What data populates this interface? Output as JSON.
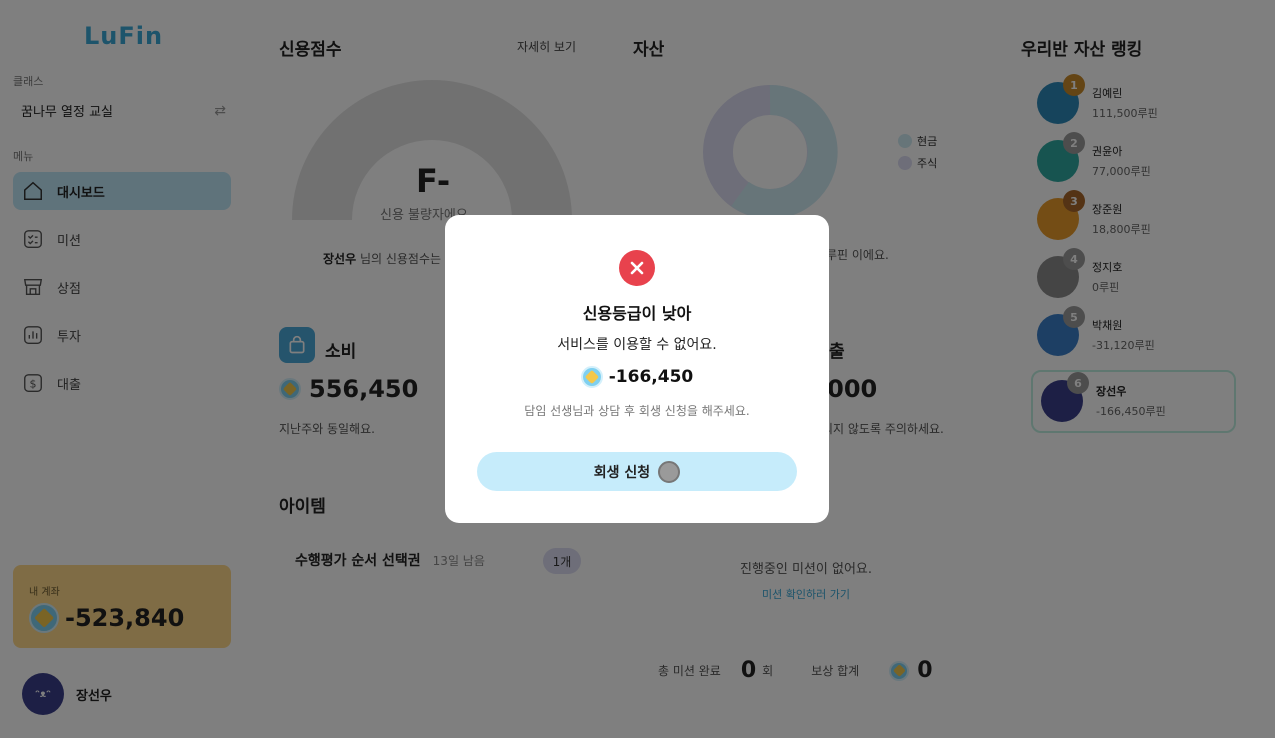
{
  "app": {
    "logo": "LuFin"
  },
  "sidebar": {
    "class_label": "클래스",
    "class_name": "꿈나무 열정 교실",
    "menu_label": "메뉴",
    "items": [
      {
        "label": "대시보드",
        "icon": "home-icon",
        "active": true
      },
      {
        "label": "미션",
        "icon": "checklist-icon"
      },
      {
        "label": "상점",
        "icon": "store-icon"
      },
      {
        "label": "투자",
        "icon": "chart-icon"
      },
      {
        "label": "대출",
        "icon": "dollar-icon"
      }
    ],
    "account": {
      "label": "내 계좌",
      "balance": "-523,840"
    },
    "user": {
      "name": "장선우"
    }
  },
  "credit": {
    "title": "신용점수",
    "detail_link": "자세히 보기",
    "grade": "F-",
    "grade_desc": "신용 불량자에요",
    "caption_name": "장선우",
    "caption_rest": " 님의 신용점수는"
  },
  "assets": {
    "title": "자산",
    "caption": "루핀 이에요.",
    "legend": [
      {
        "label": "현금",
        "color": "#cfeaf3"
      },
      {
        "label": "주식",
        "color": "#dcdcf2"
      }
    ]
  },
  "spending": {
    "title": "소비",
    "amount": "556,450",
    "note": "지난주와 동일해요."
  },
  "loan": {
    "title_partial": "출",
    "amount_partial": ",000",
    "note_partial": "되지 않도록 주의하세요."
  },
  "items": {
    "title": "아이템",
    "list": [
      {
        "name": "수행평가 순서 선택권",
        "days": "13일 남음",
        "count": "1개"
      }
    ]
  },
  "missions": {
    "empty": "진행중인 미션이 없어요.",
    "link": "미션 확인하러 가기",
    "completed_label": "총 미션 완료",
    "completed_count": "0",
    "completed_unit": "회",
    "reward_label": "보상 합계",
    "reward_total": "0"
  },
  "ranking": {
    "title": "우리반 자산 랭킹",
    "list": [
      {
        "rank": "1",
        "name": "김예린",
        "amount": "111,500루핀",
        "color": "#2c88b8",
        "badge": "#c98a2a"
      },
      {
        "rank": "2",
        "name": "권윤아",
        "amount": "77,000루핀",
        "color": "#2fa8a0",
        "badge": "#9a9a9a"
      },
      {
        "rank": "3",
        "name": "장준원",
        "amount": "18,800루핀",
        "color": "#e89b2a",
        "badge": "#a8662a"
      },
      {
        "rank": "4",
        "name": "정지호",
        "amount": "0루핀",
        "color": "#8a8a8a",
        "badge": "#9a9a9a"
      },
      {
        "rank": "5",
        "name": "박채원",
        "amount": "-31,120루핀",
        "color": "#3a7ec8",
        "badge": "#9a9a9a"
      },
      {
        "rank": "6",
        "name": "장선우",
        "amount": "-166,450루핀",
        "color": "#3a3f8a",
        "badge": "#9a9a9a"
      }
    ]
  },
  "modal": {
    "title": "신용등급이 낮아",
    "message": "서비스를 이용할 수 없어요.",
    "amount": "-166,450",
    "hint": "담임 선생님과 상담 후 회생 신청을 해주세요.",
    "button": "회생 신청"
  }
}
